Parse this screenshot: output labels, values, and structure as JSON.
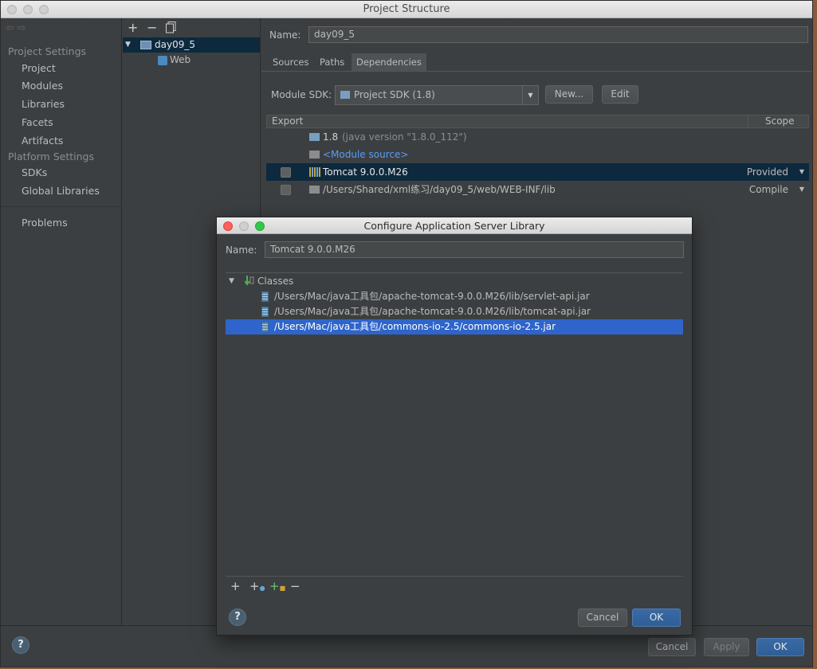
{
  "window": {
    "title": "Project Structure"
  },
  "left": {
    "project_settings_header": "Project Settings",
    "project_items": [
      "Project",
      "Modules",
      "Libraries",
      "Facets",
      "Artifacts"
    ],
    "platform_settings_header": "Platform Settings",
    "platform_items": [
      "SDKs",
      "Global Libraries"
    ],
    "problems": "Problems"
  },
  "toolbar": {
    "add": "+",
    "remove": "−"
  },
  "module_tree": {
    "root": "day09_5",
    "child": "Web"
  },
  "module": {
    "name_label": "Name:",
    "name_value": "day09_5",
    "tabs": [
      "Sources",
      "Paths",
      "Dependencies"
    ],
    "active_tab": "Dependencies",
    "sdk_label": "Module SDK:",
    "sdk_value": "Project SDK (1.8)",
    "new_button": "New...",
    "edit_button": "Edit"
  },
  "dependencies": {
    "col_export": "Export",
    "col_scope": "Scope",
    "rows": [
      {
        "name": "1.8",
        "detail": "(java version \"1.8.0_112\")",
        "scope": ""
      },
      {
        "name": "<Module source>",
        "detail": "",
        "scope": ""
      },
      {
        "name": "Tomcat 9.0.0.M26",
        "detail": "",
        "scope": "Provided"
      },
      {
        "name": "/Users/Shared/xml练习/day09_5/web/WEB-INF/lib",
        "detail": "",
        "scope": "Compile"
      }
    ]
  },
  "bottom": {
    "cancel": "Cancel",
    "apply": "Apply",
    "ok": "OK",
    "help": "?"
  },
  "dialog": {
    "title": "Configure Application Server Library",
    "name_label": "Name:",
    "name_value": "Tomcat 9.0.0.M26",
    "classes_label": "Classes",
    "jars": [
      "/Users/Mac/java工具包/apache-tomcat-9.0.0.M26/lib/servlet-api.jar",
      "/Users/Mac/java工具包/apache-tomcat-9.0.0.M26/lib/tomcat-api.jar",
      "/Users/Mac/java工具包/commons-io-2.5/commons-io-2.5.jar"
    ],
    "selected_jar_index": 2,
    "cancel": "Cancel",
    "ok": "OK",
    "help": "?"
  },
  "colors": {
    "background": "#3c3f41",
    "selection_dark": "#0d293e",
    "selection_blue": "#2f65ca",
    "link": "#589df6",
    "primary_button": "#2f5e96"
  }
}
